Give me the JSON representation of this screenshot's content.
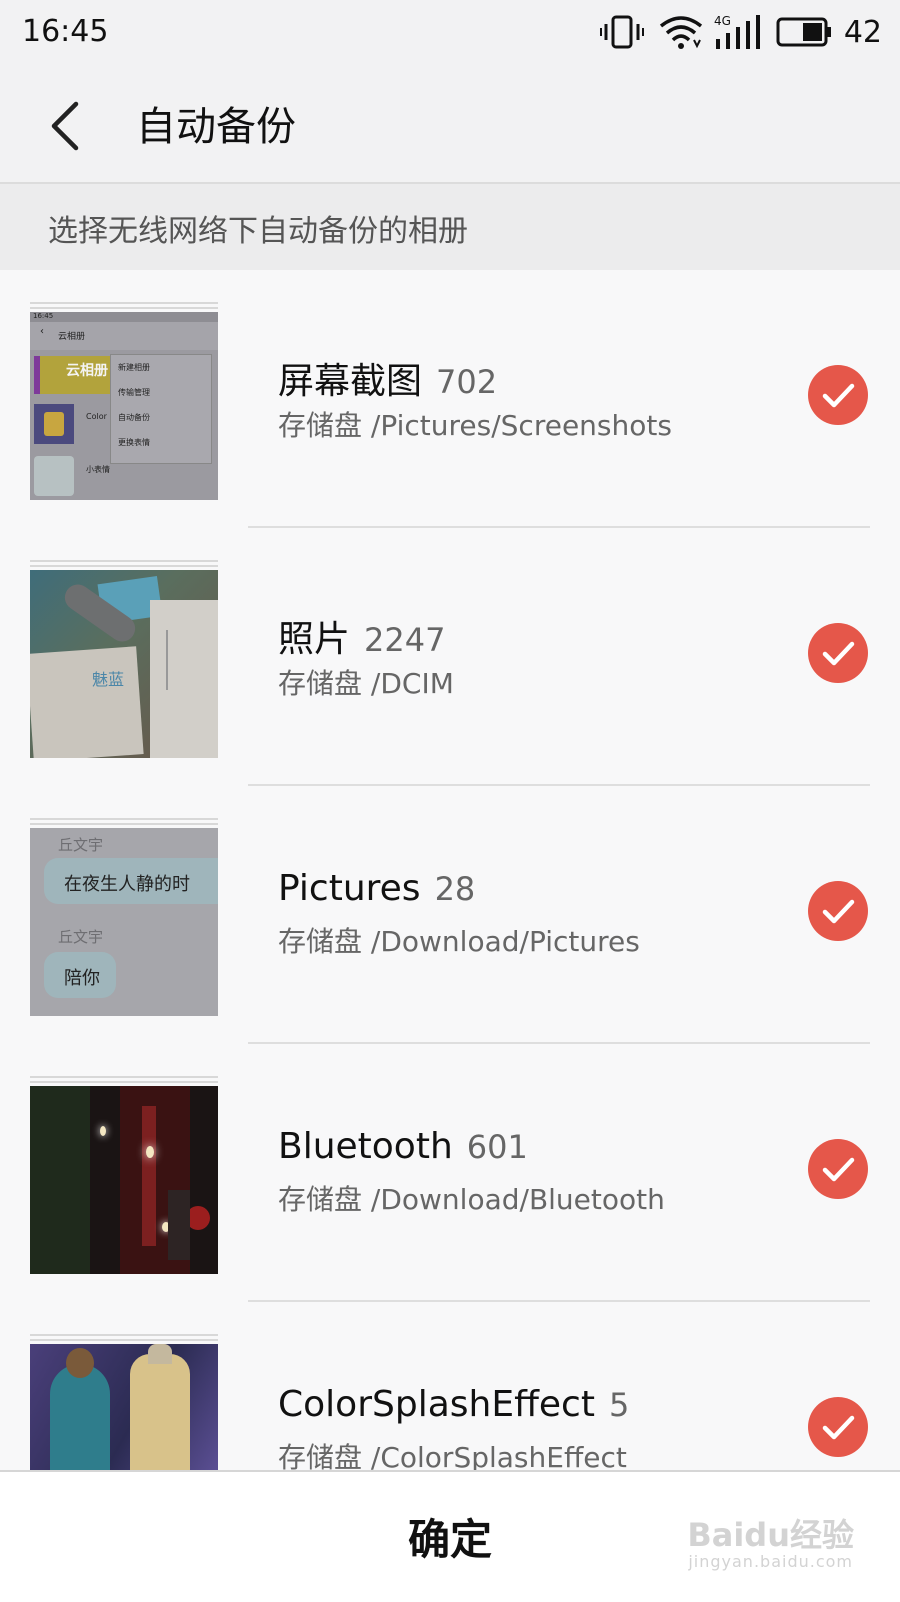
{
  "status_bar": {
    "time": "16:45",
    "network": "4G",
    "battery": "42"
  },
  "header": {
    "title": "自动备份",
    "back_icon": "chevron-left-icon"
  },
  "hint": "选择无线网络下自动备份的相册",
  "albums": [
    {
      "name": "屏幕截图",
      "count": "702",
      "path": "存储盘 /Pictures/Screenshots",
      "selected": true
    },
    {
      "name": "照片",
      "count": "2247",
      "path": "存储盘 /DCIM",
      "selected": true
    },
    {
      "name": "Pictures",
      "count": "28",
      "path": "存储盘 /Download/Pictures",
      "selected": true
    },
    {
      "name": "Bluetooth",
      "count": "601",
      "path": "存储盘 /Download/Bluetooth",
      "selected": true
    },
    {
      "name": "ColorSplashEffect",
      "count": "5",
      "path": "存储盘 /ColorSplashEffect",
      "selected": true
    }
  ],
  "thumb_screenshot": {
    "time": "16:45",
    "title": "云相册",
    "menu": [
      "新建相册",
      "传输管理",
      "自动备份",
      "更换表情"
    ],
    "color_label": "Color",
    "sticker_label": "小表情"
  },
  "thumb_chat": {
    "sender": "丘文宇",
    "msg1": "在夜生人静的时",
    "msg2": "陪你"
  },
  "thumb_photo": {
    "box_text": "魅蓝"
  },
  "confirm_label": "确定",
  "watermark": {
    "brand": "Baidu经验",
    "url": "jingyan.baidu.com"
  },
  "colors": {
    "accent": "#e5574a"
  }
}
